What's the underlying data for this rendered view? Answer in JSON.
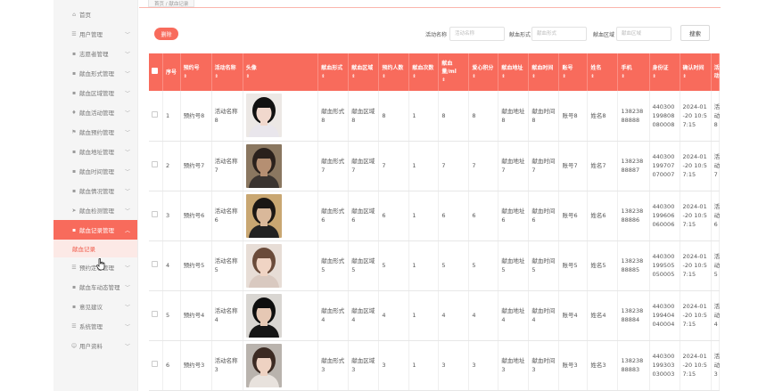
{
  "top_tab": "首页 / 献血记录",
  "sidebar": {
    "items": [
      {
        "label": "首页",
        "icon": "home-icon",
        "glyph": "⌂",
        "chev": false
      },
      {
        "label": "用户管理",
        "icon": "list-icon",
        "glyph": "☰",
        "chev": true
      },
      {
        "label": "志愿者管理",
        "icon": "grid-icon",
        "glyph": "▪",
        "chev": true
      },
      {
        "label": "献血形式管理",
        "icon": "grid-icon",
        "glyph": "▪",
        "chev": true
      },
      {
        "label": "献血区域管理",
        "icon": "grid-icon",
        "glyph": "▪",
        "chev": true
      },
      {
        "label": "献血活动管理",
        "icon": "bulb-icon",
        "glyph": "♦",
        "chev": true
      },
      {
        "label": "献血预约管理",
        "icon": "flag-icon",
        "glyph": "⚑",
        "chev": true
      },
      {
        "label": "献血地址管理",
        "icon": "grid-icon",
        "glyph": "▪",
        "chev": true
      },
      {
        "label": "献血时间管理",
        "icon": "grid-icon",
        "glyph": "▪",
        "chev": true
      },
      {
        "label": "献血情况管理",
        "icon": "grid-icon",
        "glyph": "▪",
        "chev": true
      },
      {
        "label": "献血检测管理",
        "icon": "send-icon",
        "glyph": "➤",
        "chev": true
      },
      {
        "label": "献血记录管理",
        "icon": "grid-icon",
        "glyph": "▪",
        "chev": true,
        "active": true
      }
    ],
    "sub_item": "献血记录",
    "items_after": [
      {
        "label": "预约定心管理",
        "icon": "list-icon",
        "glyph": "☰",
        "chev": true
      },
      {
        "label": "献血车动态管理",
        "icon": "grid-icon",
        "glyph": "▪",
        "chev": true
      },
      {
        "label": "意见建议",
        "icon": "grid-icon",
        "glyph": "▪",
        "chev": true
      },
      {
        "label": "系统管理",
        "icon": "list-icon",
        "glyph": "☰",
        "chev": true
      },
      {
        "label": "用户资料",
        "icon": "user-icon",
        "glyph": "☺",
        "chev": true
      }
    ]
  },
  "toolbar": {
    "add_label": "删除",
    "search": [
      {
        "label": "活动名称",
        "placeholder": "活动名称"
      },
      {
        "label": "献血形式",
        "placeholder": "献血形式"
      },
      {
        "label": "献血区域",
        "placeholder": "献血区域"
      }
    ],
    "search_label": "搜索"
  },
  "table": {
    "headers": [
      "序号",
      "预约号",
      "活动名称",
      "头像",
      "献血形式",
      "献血区域",
      "预约人数",
      "献血次数",
      "献血量/ml",
      "爱心积分",
      "献血地址",
      "献血时间",
      "账号",
      "姓名",
      "手机",
      "身份证",
      "确认时间",
      "活动"
    ],
    "rows": [
      {
        "idx": "1",
        "yuyue": "预约号8",
        "huodong": "活动名称8",
        "xingshi": "献血形式8",
        "quyu": "献血区域8",
        "renshu": "8",
        "cishu": "1",
        "liang": "8",
        "jifen": "8",
        "dizhi": "献血地址8",
        "shijian": "献血时间8",
        "zhanghao": "账号8",
        "xingming": "姓名8",
        "shouji": "13823888888",
        "shenfen": "440300199808080008",
        "queren": "2024-01-20 10:57:15",
        "extra": "活动8",
        "avatar": {
          "bg": "#ece8e5",
          "hair": "#111111",
          "skin": "#f1d8cd",
          "cloth": "#e9e6ec"
        }
      },
      {
        "idx": "2",
        "yuyue": "预约号7",
        "huodong": "活动名称7",
        "xingshi": "献血形式7",
        "quyu": "献血区域7",
        "renshu": "7",
        "cishu": "1",
        "liang": "7",
        "jifen": "7",
        "dizhi": "献血地址7",
        "shijian": "献血时间7",
        "zhanghao": "账号7",
        "xingming": "姓名7",
        "shouji": "13823888887",
        "shenfen": "440300199707070007",
        "queren": "2024-01-20 10:57:15",
        "extra": "活动7",
        "avatar": {
          "bg": "#8a7760",
          "hair": "#2a211c",
          "skin": "#b58f72",
          "cloth": "#3a3430"
        }
      },
      {
        "idx": "3",
        "yuyue": "预约号6",
        "huodong": "活动名称6",
        "xingshi": "献血形式6",
        "quyu": "献血区域6",
        "renshu": "6",
        "cishu": "1",
        "liang": "6",
        "jifen": "6",
        "dizhi": "献血地址6",
        "shijian": "献血时间6",
        "zhanghao": "账号6",
        "xingming": "姓名6",
        "shouji": "13823888886",
        "shenfen": "440300199606060006",
        "queren": "2024-01-20 10:57:15",
        "extra": "活动6",
        "avatar": {
          "bg": "#c9a772",
          "hair": "#1b1714",
          "skin": "#d9b89a",
          "cloth": "#222222"
        }
      },
      {
        "idx": "4",
        "yuyue": "预约号5",
        "huodong": "活动名称5",
        "xingshi": "献血形式5",
        "quyu": "献血区域5",
        "renshu": "5",
        "cishu": "1",
        "liang": "5",
        "jifen": "5",
        "dizhi": "献血地址5",
        "shijian": "献血时间5",
        "zhanghao": "账号5",
        "xingming": "姓名5",
        "shouji": "13823888885",
        "shenfen": "440300199505050005",
        "queren": "2024-01-20 10:57:15",
        "extra": "活动5",
        "avatar": {
          "bg": "#e7ddd6",
          "hair": "#6a4b3a",
          "skin": "#f0d4c4",
          "cloth": "#d9c9c0"
        }
      },
      {
        "idx": "5",
        "yuyue": "预约号4",
        "huodong": "活动名称4",
        "xingshi": "献血形式4",
        "quyu": "献血区域4",
        "renshu": "4",
        "cishu": "1",
        "liang": "4",
        "jifen": "4",
        "dizhi": "献血地址4",
        "shijian": "献血时间4",
        "zhanghao": "账号4",
        "xingming": "姓名4",
        "shouji": "13823888884",
        "shenfen": "440300199404040004",
        "queren": "2024-01-20 10:57:15",
        "extra": "活动4",
        "avatar": {
          "bg": "#d9d6d2",
          "hair": "#0e0e0e",
          "skin": "#e6c8b4",
          "cloth": "#151515"
        }
      },
      {
        "idx": "6",
        "yuyue": "预约号3",
        "huodong": "活动名称3",
        "xingshi": "献血形式3",
        "quyu": "献血区域3",
        "renshu": "3",
        "cishu": "1",
        "liang": "3",
        "jifen": "3",
        "dizhi": "献血地址3",
        "shijian": "献血时间3",
        "zhanghao": "账号3",
        "xingming": "姓名3",
        "shouji": "13823888883",
        "shenfen": "440300199303030003",
        "queren": "2024-01-20 10:57:15",
        "extra": "活动3",
        "avatar": {
          "bg": "#b9b3ad",
          "hair": "#3b2a22",
          "skin": "#eed2c2",
          "cloth": "#e8e2dd"
        }
      }
    ]
  }
}
